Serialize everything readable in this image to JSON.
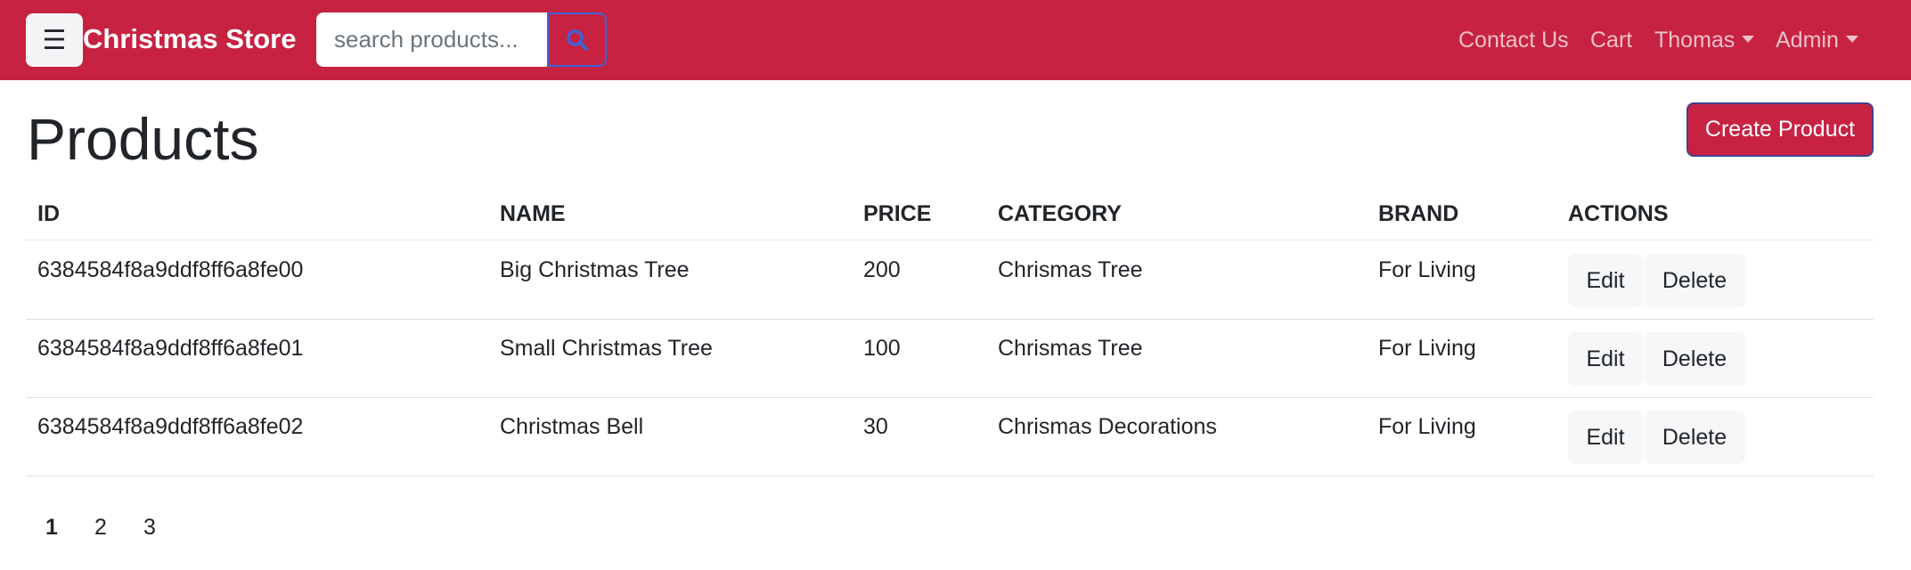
{
  "navbar": {
    "toggler_icon": "menu-icon",
    "brand": "Christmas Store",
    "search": {
      "placeholder": "search products...",
      "value": "",
      "icon": "search-icon"
    },
    "links": [
      "Contact Us",
      "Cart",
      "Thomas",
      "Admin"
    ],
    "colors": {
      "background": "#c72242",
      "search_outline": "#3d63d8"
    }
  },
  "page": {
    "title": "Products",
    "create_label": "Create Product"
  },
  "table": {
    "headers": [
      "ID",
      "NAME",
      "PRICE",
      "CATEGORY",
      "BRAND",
      "ACTIONS"
    ],
    "rows": [
      {
        "id": "6384584f8a9ddf8ff6a8fe00",
        "name": "Big Christmas Tree",
        "price": "200",
        "category": "Chrismas Tree",
        "brand": "For Living",
        "edit": "Edit",
        "delete": "Delete"
      },
      {
        "id": "6384584f8a9ddf8ff6a8fe01",
        "name": "Small Christmas Tree",
        "price": "100",
        "category": "Chrismas Tree",
        "brand": "For Living",
        "edit": "Edit",
        "delete": "Delete"
      },
      {
        "id": "6384584f8a9ddf8ff6a8fe02",
        "name": "Christmas Bell",
        "price": "30",
        "category": "Chrismas Decorations",
        "brand": "For Living",
        "edit": "Edit",
        "delete": "Delete"
      }
    ]
  },
  "pagination": {
    "pages": [
      "1",
      "2",
      "3"
    ],
    "current": "1"
  }
}
